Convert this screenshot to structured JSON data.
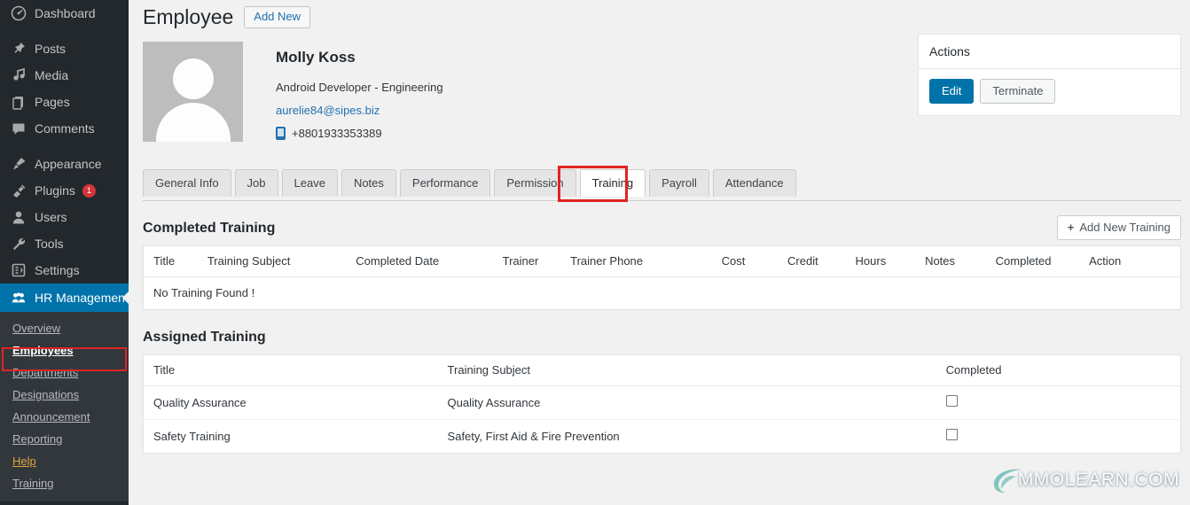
{
  "sidebar": {
    "items": [
      {
        "label": "Dashboard",
        "icon": "dashboard-icon",
        "badge": null
      },
      {
        "label": "Posts",
        "icon": "pin-icon",
        "badge": null
      },
      {
        "label": "Media",
        "icon": "media-icon",
        "badge": null
      },
      {
        "label": "Pages",
        "icon": "pages-icon",
        "badge": null
      },
      {
        "label": "Comments",
        "icon": "comments-icon",
        "badge": null
      },
      {
        "label": "Appearance",
        "icon": "brush-icon",
        "badge": null
      },
      {
        "label": "Plugins",
        "icon": "plug-icon",
        "badge": "1"
      },
      {
        "label": "Users",
        "icon": "user-icon",
        "badge": null
      },
      {
        "label": "Tools",
        "icon": "wrench-icon",
        "badge": null
      },
      {
        "label": "Settings",
        "icon": "settings-icon",
        "badge": null
      }
    ],
    "current": {
      "label": "HR Management",
      "icon": "group-icon"
    },
    "submenu": [
      {
        "label": "Overview",
        "state": "normal"
      },
      {
        "label": "Employees",
        "state": "active"
      },
      {
        "label": "Departments",
        "state": "normal"
      },
      {
        "label": "Designations",
        "state": "normal"
      },
      {
        "label": "Announcement",
        "state": "normal"
      },
      {
        "label": "Reporting",
        "state": "normal"
      },
      {
        "label": "Help",
        "state": "help"
      },
      {
        "label": "Training",
        "state": "normal"
      }
    ]
  },
  "header": {
    "title": "Employee",
    "add_new_label": "Add New"
  },
  "employee": {
    "name": "Molly Koss",
    "role": "Android Developer - Engineering",
    "email": "aurelie84@sipes.biz",
    "phone": "+8801933353389"
  },
  "actions": {
    "title": "Actions",
    "edit_label": "Edit",
    "terminate_label": "Terminate"
  },
  "tabs": [
    {
      "label": "General Info",
      "active": false
    },
    {
      "label": "Job",
      "active": false
    },
    {
      "label": "Leave",
      "active": false
    },
    {
      "label": "Notes",
      "active": false
    },
    {
      "label": "Performance",
      "active": false
    },
    {
      "label": "Permission",
      "active": false
    },
    {
      "label": "Training",
      "active": true
    },
    {
      "label": "Payroll",
      "active": false
    },
    {
      "label": "Attendance",
      "active": false
    }
  ],
  "completed_training": {
    "section_title": "Completed Training",
    "add_button_label": "Add New Training",
    "add_button_icon": "plus-icon",
    "columns": [
      "Title",
      "Training Subject",
      "Completed Date",
      "Trainer",
      "Trainer Phone",
      "Cost",
      "Credit",
      "Hours",
      "Notes",
      "Completed",
      "Action"
    ],
    "empty_message": "No Training Found !",
    "rows": []
  },
  "assigned_training": {
    "section_title": "Assigned Training",
    "columns": [
      "Title",
      "Training Subject",
      "Completed"
    ],
    "rows": [
      {
        "title": "Quality Assurance",
        "subject": "Quality Assurance",
        "completed": false
      },
      {
        "title": "Safety Training",
        "subject": "Safety, First Aid & Fire Prevention",
        "completed": false
      }
    ]
  },
  "watermark": {
    "text": "MMOLEARN.COM"
  },
  "colors": {
    "sidebar_bg": "#23282d",
    "submenu_bg": "#32373c",
    "accent_blue": "#0073aa",
    "link_blue": "#2271b1",
    "badge_red": "#d63638",
    "help_orange": "#e0a33c",
    "annotation_red": "#e02424",
    "page_bg": "#f1f1f1"
  }
}
